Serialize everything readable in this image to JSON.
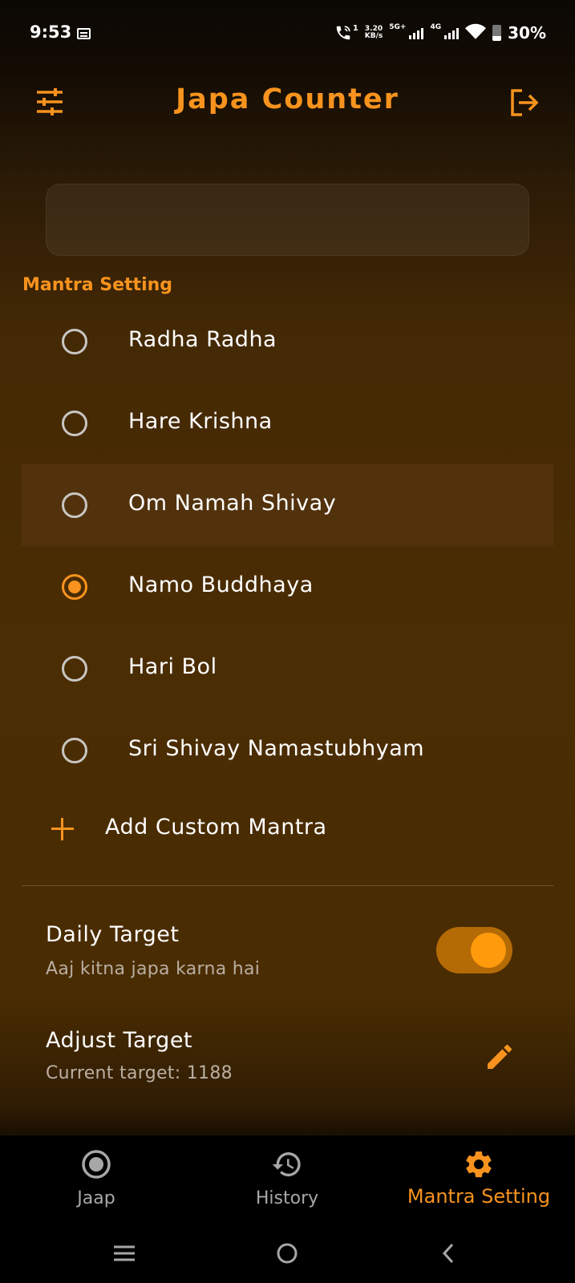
{
  "status_bar": {
    "time": "9:53",
    "call_sim": "1",
    "net_speed_value": "3.20",
    "net_speed_unit": "KB/s",
    "net_5g": "5G+",
    "net_4g": "4G",
    "battery": "30%"
  },
  "header": {
    "title": "Japa Counter"
  },
  "search": {
    "placeholder": ""
  },
  "section": {
    "label": "Mantra Setting"
  },
  "mantras": {
    "items": [
      {
        "label": "Radha Radha",
        "selected": false
      },
      {
        "label": "Hare Krishna",
        "selected": false
      },
      {
        "label": "Om Namah Shivay",
        "selected": false
      },
      {
        "label": "Namo Buddhaya",
        "selected": true
      },
      {
        "label": "Hari Bol",
        "selected": false
      },
      {
        "label": "Sri Shivay Namastubhyam",
        "selected": false
      }
    ],
    "add_label": "Add Custom Mantra"
  },
  "settings": {
    "daily_target_title": "Daily Target",
    "daily_target_sub": "Aaj kitna japa karna hai",
    "daily_target_enabled": true,
    "adjust_title": "Adjust Target",
    "adjust_sub": "Current target: 1188"
  },
  "bottom_nav": {
    "items": [
      {
        "label": "Jaap",
        "icon": "radio-target-icon"
      },
      {
        "label": "History",
        "icon": "history-icon"
      },
      {
        "label": "Mantra Setting",
        "icon": "gear-icon"
      }
    ],
    "active": "Mantra Setting"
  },
  "colors": {
    "accent": "#f7931e",
    "toggle_track": "#b46a05",
    "highlight_row": "#52320c"
  }
}
